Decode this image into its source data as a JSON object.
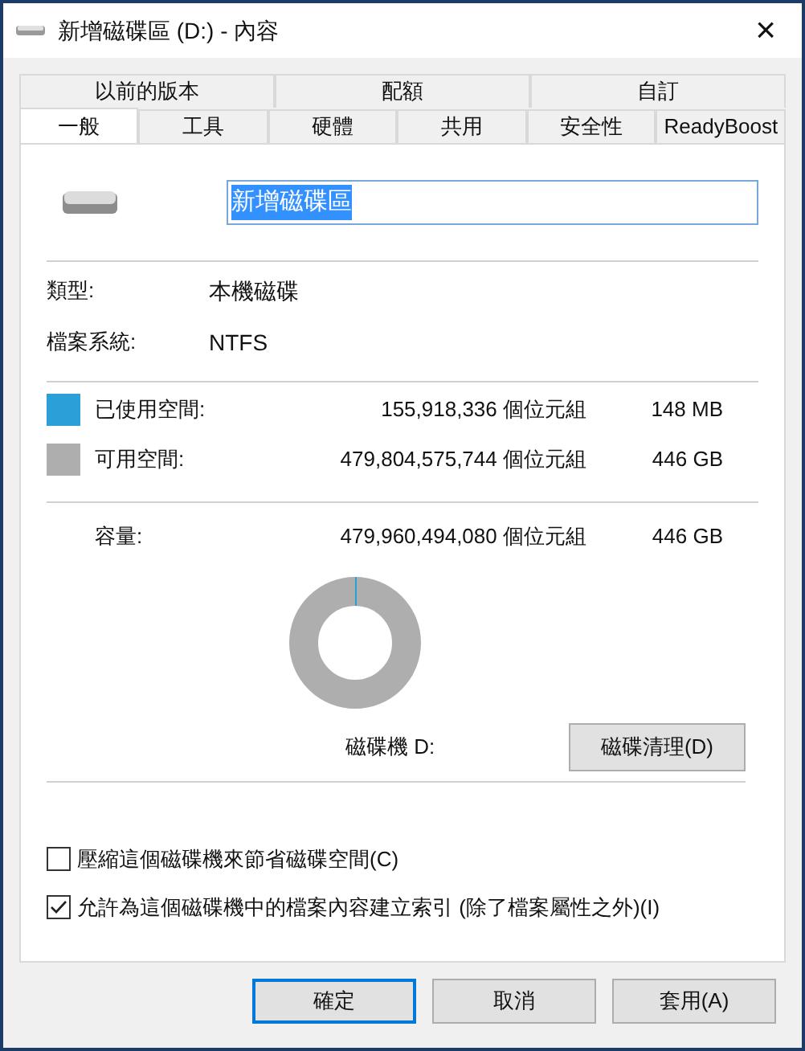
{
  "window": {
    "title": "新增磁碟區 (D:) - 內容",
    "close": "×"
  },
  "tabs_back": [
    {
      "label": "以前的版本",
      "selected": false
    },
    {
      "label": "配額",
      "selected": false
    },
    {
      "label": "自訂",
      "selected": false
    }
  ],
  "tabs_front": [
    {
      "label": "一般",
      "selected": true
    },
    {
      "label": "工具",
      "selected": false
    },
    {
      "label": "硬體",
      "selected": false
    },
    {
      "label": "共用",
      "selected": false
    },
    {
      "label": "安全性",
      "selected": false
    },
    {
      "label": "ReadyBoost",
      "selected": false
    }
  ],
  "name_field": {
    "value": "新增磁碟區"
  },
  "info": [
    {
      "label": "類型:",
      "value": "本機磁碟"
    },
    {
      "label": "檔案系統:",
      "value": "NTFS"
    }
  ],
  "space": [
    {
      "label": "已使用空間:",
      "bytes": "155,918,336 個位元組",
      "size": "148 MB",
      "color": "#2a9fd8"
    },
    {
      "label": "可用空間:",
      "bytes": "479,804,575,744 個位元組",
      "size": "446 GB",
      "color": "#aeaeae"
    }
  ],
  "capacity": {
    "label": "容量:",
    "bytes": "479,960,494,080 個位元組",
    "size": "446 GB"
  },
  "drive_label": "磁碟機 D:",
  "cleanup_button": "磁碟清理(D)",
  "options": [
    {
      "label": "壓縮這個磁碟機來節省磁碟空間(C)",
      "checked": false
    },
    {
      "label": "允許為這個磁碟機中的檔案內容建立索引 (除了檔案屬性之外)(I)",
      "checked": true
    }
  ],
  "buttons": [
    {
      "label": "確定",
      "selected": true
    },
    {
      "label": "取消",
      "selected": false
    },
    {
      "label": "套用(A)",
      "selected": false
    }
  ]
}
